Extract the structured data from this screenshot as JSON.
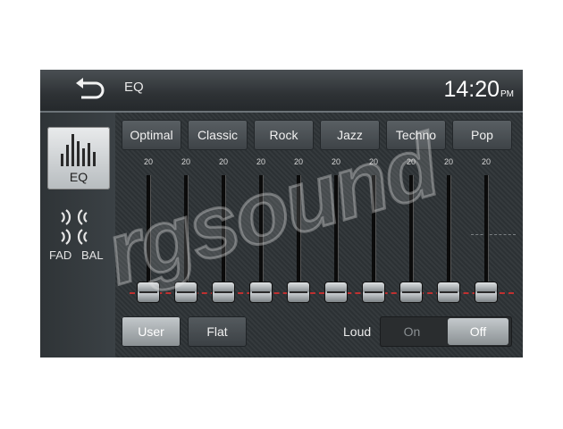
{
  "header": {
    "title": "EQ",
    "time": "14:20",
    "ampm": "PM"
  },
  "sidebar": {
    "eq_label": "EQ",
    "fad_label": "FAD",
    "bal_label": "BAL"
  },
  "presets": [
    "Optimal",
    "Classic",
    "Rock",
    "Jazz",
    "Techno",
    "Pop"
  ],
  "bands": [
    {
      "label": "20",
      "level": 0
    },
    {
      "label": "20",
      "level": 0
    },
    {
      "label": "20",
      "level": 0
    },
    {
      "label": "20",
      "level": 0
    },
    {
      "label": "20",
      "level": 0
    },
    {
      "label": "20",
      "level": 0
    },
    {
      "label": "20",
      "level": 0
    },
    {
      "label": "20",
      "level": 0
    },
    {
      "label": "20",
      "level": 0
    },
    {
      "label": "20",
      "level": 0
    }
  ],
  "controls": {
    "user": "User",
    "flat": "Flat",
    "loud_label": "Loud",
    "on": "On",
    "off": "Off",
    "loud_state": "Off"
  },
  "watermark": "rgsound"
}
